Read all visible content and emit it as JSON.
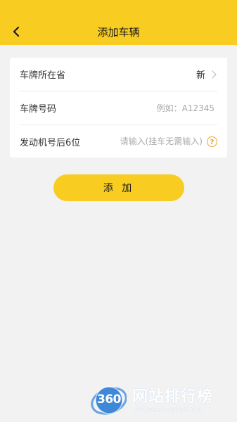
{
  "header": {
    "title": "添加车辆",
    "back_icon": "chevron-left-icon"
  },
  "form": {
    "province": {
      "label": "车牌所在省",
      "value": "新",
      "icon": "chevron-right-icon"
    },
    "plate": {
      "label": "车牌号码",
      "placeholder": "例如：A12345"
    },
    "engine": {
      "label": "发动机号后6位",
      "placeholder": "请输入(挂车无需输入)",
      "help_icon": "question-circle-icon",
      "help_glyph": "?"
    }
  },
  "actions": {
    "add_label": "添 加"
  },
  "watermark": {
    "logo": "360",
    "title": "网站排行榜",
    "subtitle": "-WANGZHAN360.CN-"
  },
  "colors": {
    "accent": "#f8cc20",
    "background": "#f2f2f2",
    "help": "#f0a020"
  }
}
